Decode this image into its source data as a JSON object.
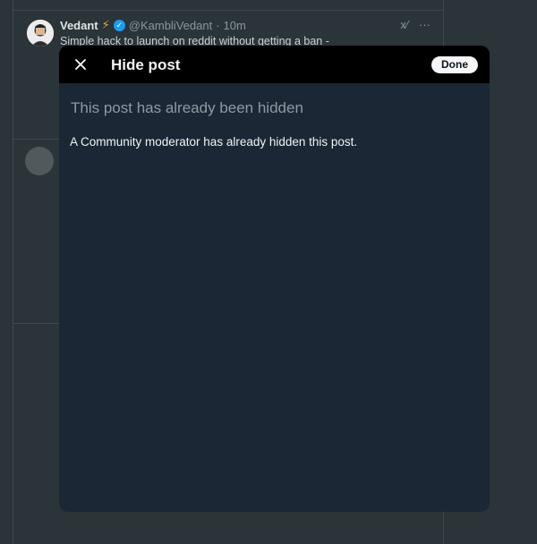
{
  "feed": {
    "post": {
      "author_name": "Vedant",
      "badge_emoji": "⚡",
      "verified_mark": "✓",
      "handle": "@KambliVedant",
      "separator": "·",
      "time": "10m",
      "text": "Simple hack to launch on reddit without getting a ban -",
      "grok_label": "x⁄",
      "more_label": "···"
    }
  },
  "modal": {
    "title": "Hide post",
    "done_label": "Done",
    "heading": "This post has already been hidden",
    "body": "A Community moderator has already hidden this post."
  },
  "colors": {
    "background": "#2b3438",
    "modal_background": "#1b2734",
    "header_background": "#000000",
    "verified": "#1d9bf0"
  }
}
